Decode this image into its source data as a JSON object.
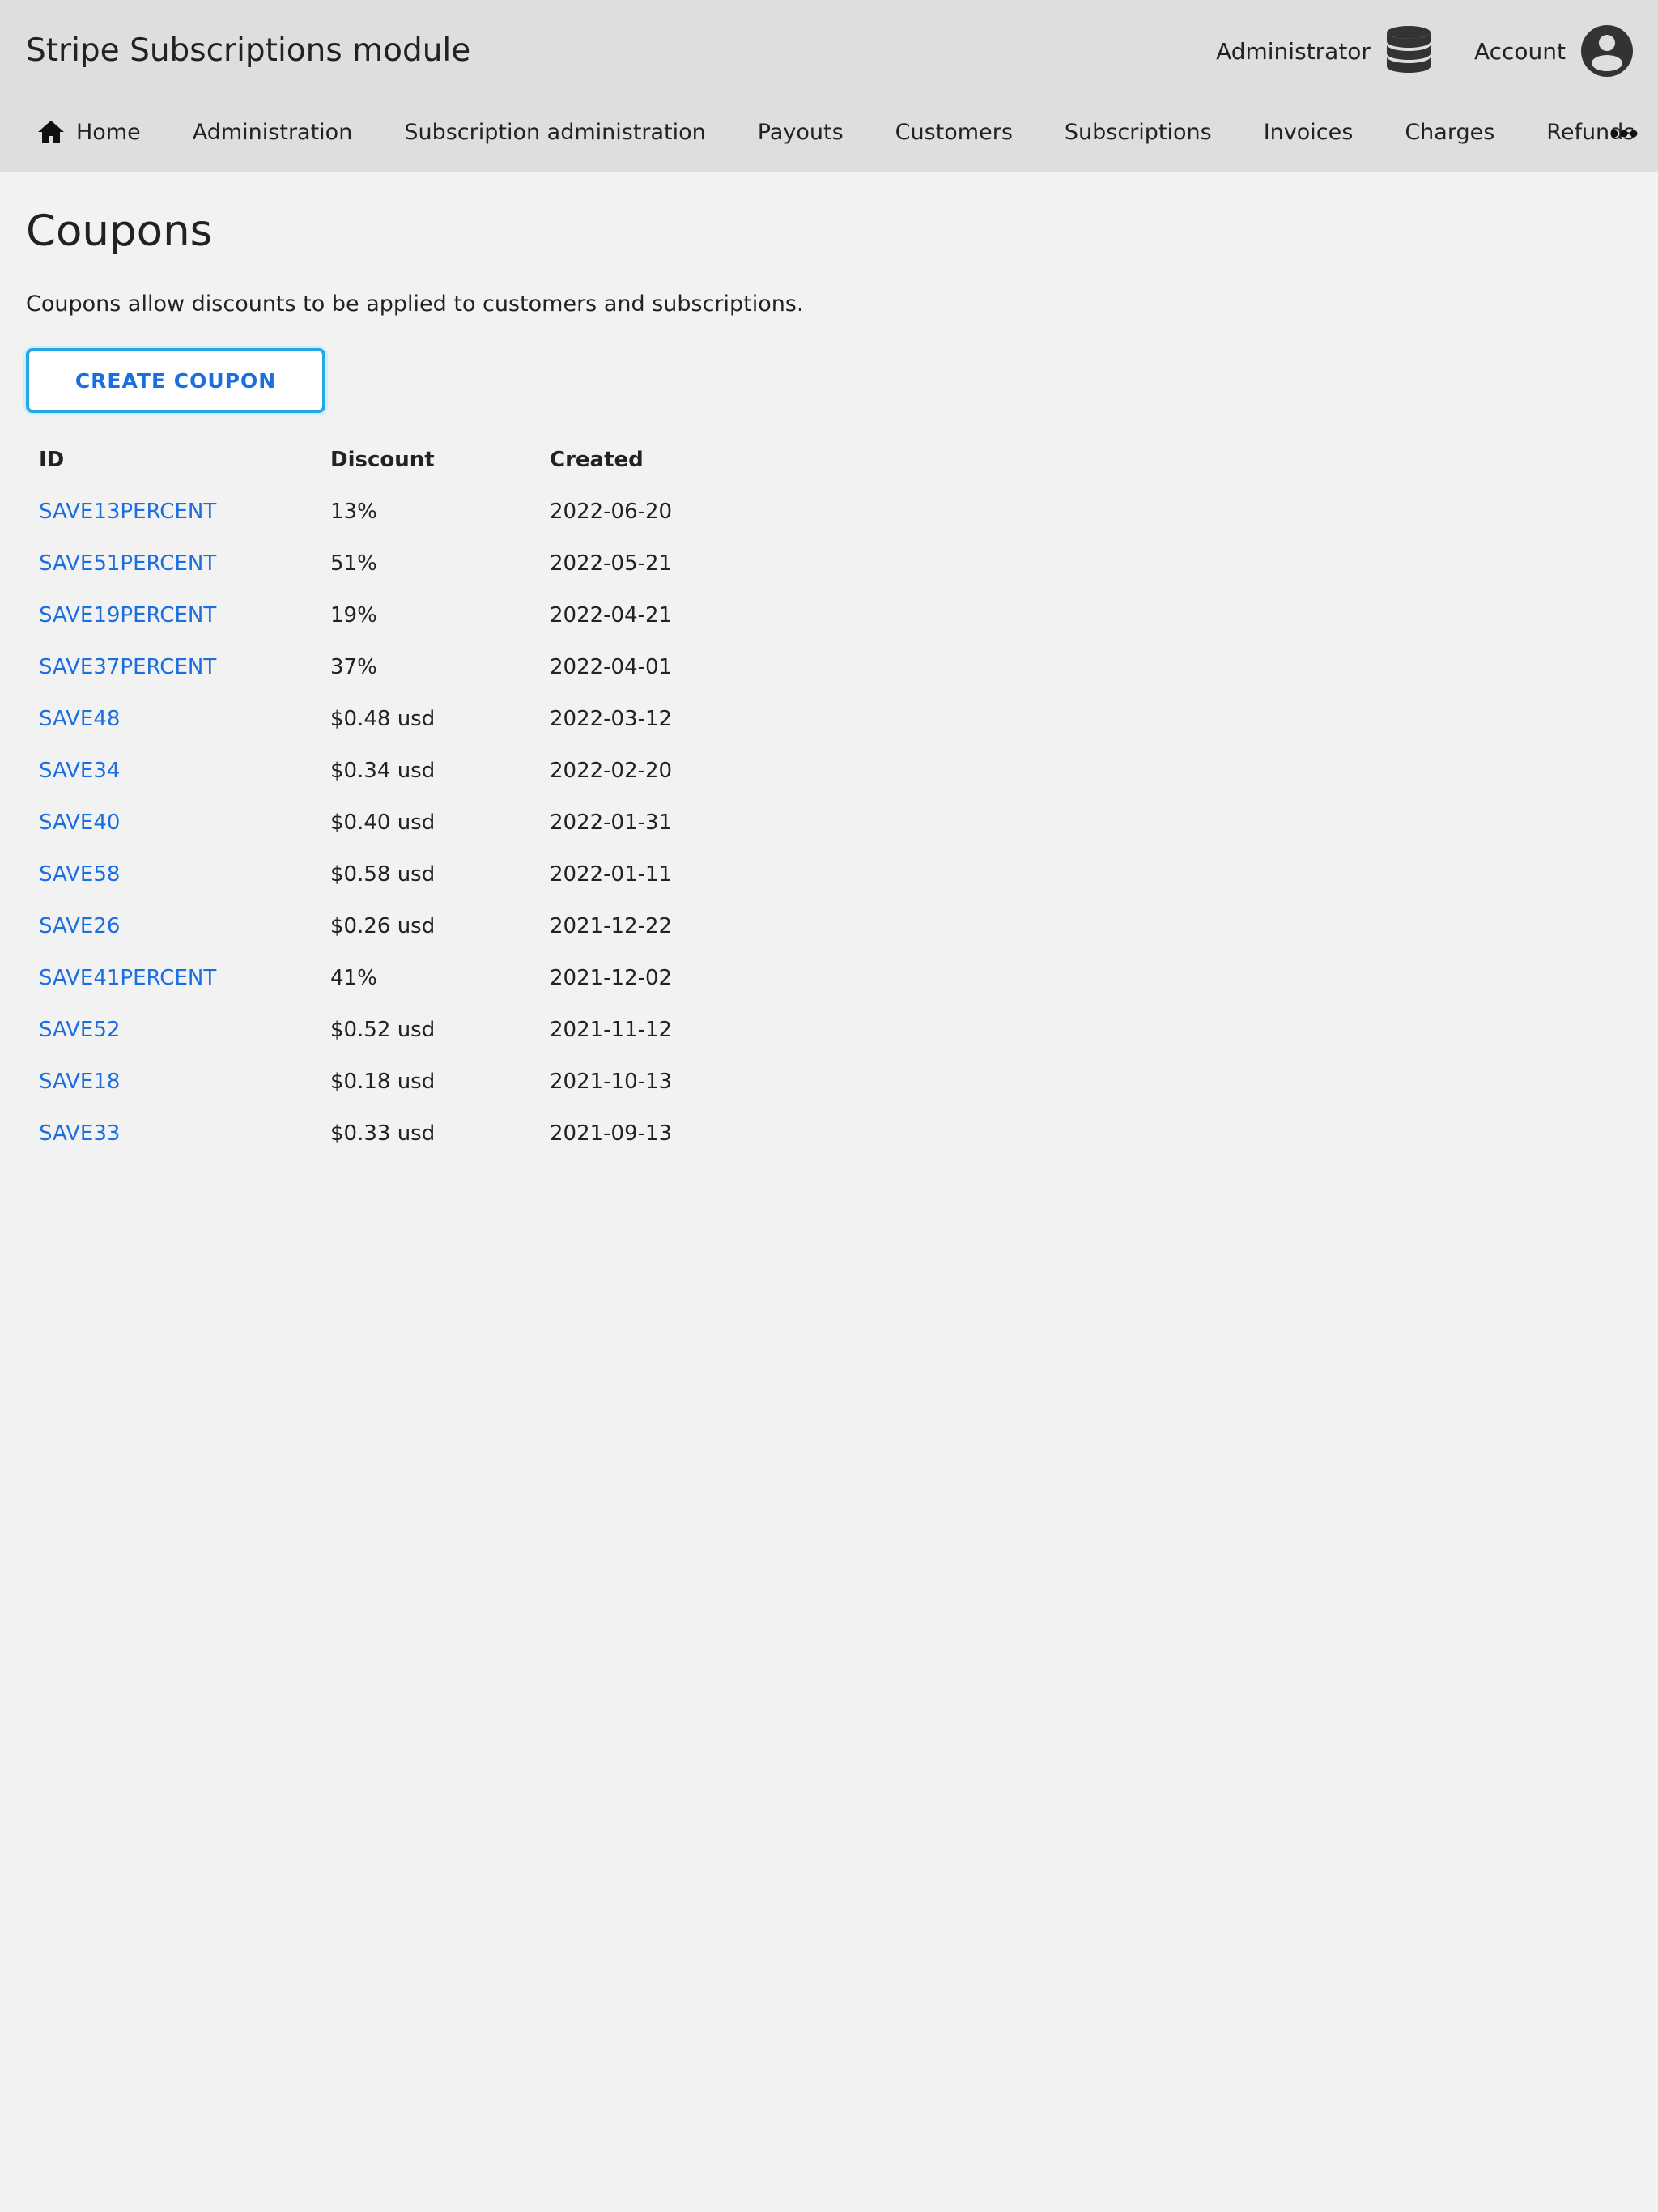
{
  "header": {
    "site_title": "Stripe Subscriptions module",
    "user_menu": {
      "administrator_label": "Administrator",
      "administrator_icon": "database-icon",
      "account_label": "Account",
      "account_icon": "user-circle-icon"
    }
  },
  "nav": {
    "items": [
      {
        "label": "Home",
        "icon": "home-icon"
      },
      {
        "label": "Administration"
      },
      {
        "label": "Subscription administration"
      },
      {
        "label": "Payouts"
      },
      {
        "label": "Customers"
      },
      {
        "label": "Subscriptions"
      },
      {
        "label": "Invoices"
      },
      {
        "label": "Charges"
      },
      {
        "label": "Refunds"
      }
    ],
    "more_icon": "more-horizontal-icon"
  },
  "main": {
    "title": "Coupons",
    "description": "Coupons allow discounts to be applied to customers and subscriptions.",
    "create_button": "CREATE COUPON",
    "table": {
      "columns": [
        "ID",
        "Discount",
        "Created"
      ],
      "rows": [
        {
          "id": "SAVE13PERCENT",
          "discount": "13%",
          "created": "2022-06-20"
        },
        {
          "id": "SAVE51PERCENT",
          "discount": "51%",
          "created": "2022-05-21"
        },
        {
          "id": "SAVE19PERCENT",
          "discount": "19%",
          "created": "2022-04-21"
        },
        {
          "id": "SAVE37PERCENT",
          "discount": "37%",
          "created": "2022-04-01"
        },
        {
          "id": "SAVE48",
          "discount": "$0.48 usd",
          "created": "2022-03-12"
        },
        {
          "id": "SAVE34",
          "discount": "$0.34 usd",
          "created": "2022-02-20"
        },
        {
          "id": "SAVE40",
          "discount": "$0.40 usd",
          "created": "2022-01-31"
        },
        {
          "id": "SAVE58",
          "discount": "$0.58 usd",
          "created": "2022-01-11"
        },
        {
          "id": "SAVE26",
          "discount": "$0.26 usd",
          "created": "2021-12-22"
        },
        {
          "id": "SAVE41PERCENT",
          "discount": "41%",
          "created": "2021-12-02"
        },
        {
          "id": "SAVE52",
          "discount": "$0.52 usd",
          "created": "2021-11-12"
        },
        {
          "id": "SAVE18",
          "discount": "$0.18 usd",
          "created": "2021-10-13"
        },
        {
          "id": "SAVE33",
          "discount": "$0.33 usd",
          "created": "2021-09-13"
        }
      ]
    }
  },
  "colors": {
    "header_bg": "#dedede",
    "page_bg": "#f2f2f2",
    "link": "#1a6ee0",
    "button_border": "#26a9e0",
    "text": "#222222",
    "icon": "#333333"
  }
}
